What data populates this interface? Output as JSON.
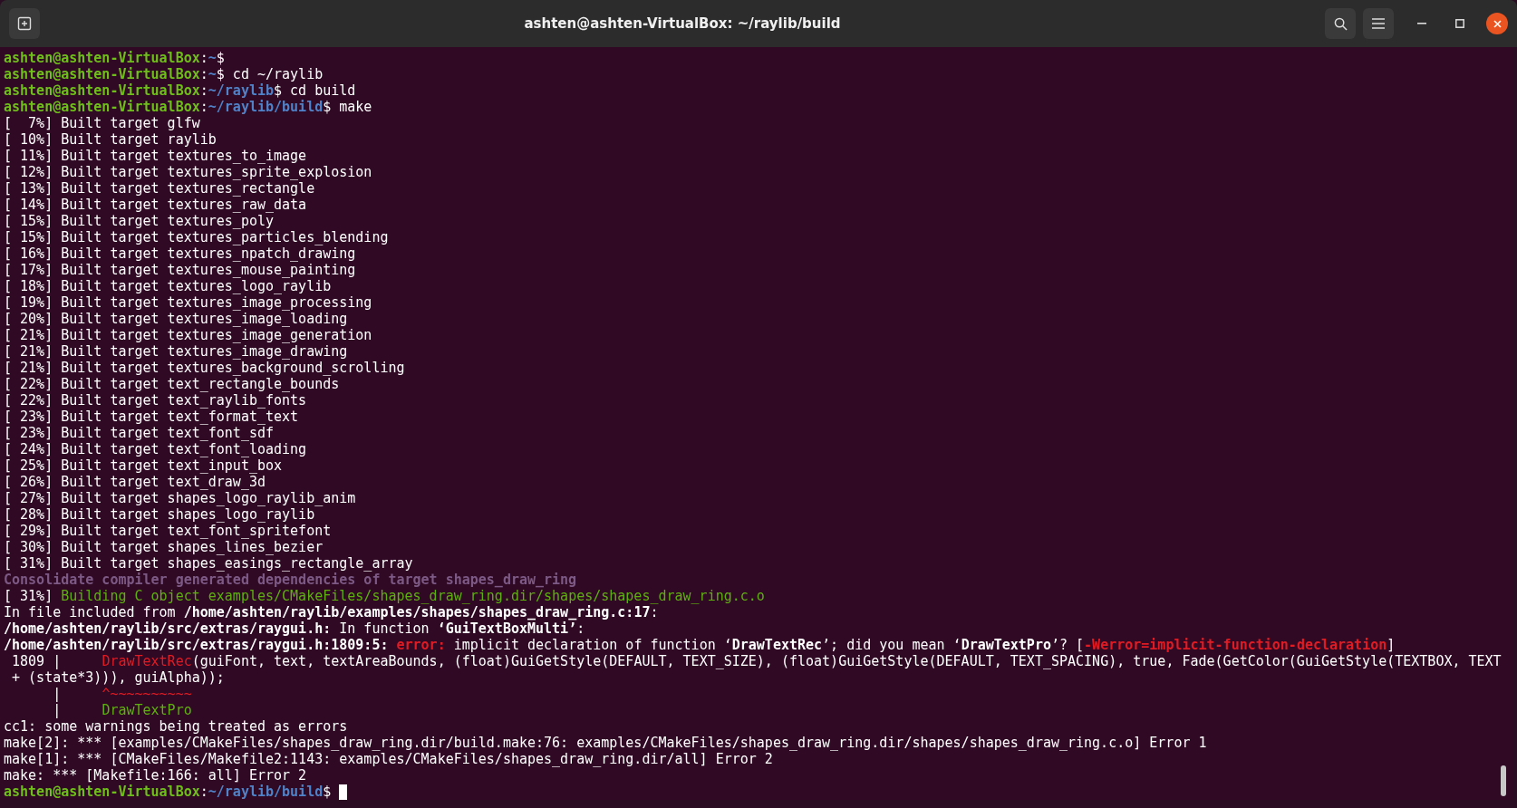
{
  "window": {
    "title": "ashten@ashten-VirtualBox: ~/raylib/build"
  },
  "terminal": {
    "cursor": true,
    "lines": [
      [
        {
          "kind": "user",
          "text": "ashten@ashten-VirtualBox"
        },
        {
          "kind": "plain",
          "text": ":"
        },
        {
          "kind": "path",
          "text": "~"
        },
        {
          "kind": "plain",
          "text": "$"
        }
      ],
      [
        {
          "kind": "user",
          "text": "ashten@ashten-VirtualBox"
        },
        {
          "kind": "plain",
          "text": ":"
        },
        {
          "kind": "path",
          "text": "~"
        },
        {
          "kind": "plain",
          "text": "$ cd ~/raylib"
        }
      ],
      [
        {
          "kind": "user",
          "text": "ashten@ashten-VirtualBox"
        },
        {
          "kind": "plain",
          "text": ":"
        },
        {
          "kind": "path",
          "text": "~/raylib"
        },
        {
          "kind": "plain",
          "text": "$ cd build"
        }
      ],
      [
        {
          "kind": "user",
          "text": "ashten@ashten-VirtualBox"
        },
        {
          "kind": "plain",
          "text": ":"
        },
        {
          "kind": "path",
          "text": "~/raylib/build"
        },
        {
          "kind": "plain",
          "text": "$ make"
        }
      ],
      [
        {
          "kind": "plain",
          "text": "[  7%] Built target glfw"
        }
      ],
      [
        {
          "kind": "plain",
          "text": "[ 10%] Built target raylib"
        }
      ],
      [
        {
          "kind": "plain",
          "text": "[ 11%] Built target textures_to_image"
        }
      ],
      [
        {
          "kind": "plain",
          "text": "[ 12%] Built target textures_sprite_explosion"
        }
      ],
      [
        {
          "kind": "plain",
          "text": "[ 13%] Built target textures_rectangle"
        }
      ],
      [
        {
          "kind": "plain",
          "text": "[ 14%] Built target textures_raw_data"
        }
      ],
      [
        {
          "kind": "plain",
          "text": "[ 15%] Built target textures_poly"
        }
      ],
      [
        {
          "kind": "plain",
          "text": "[ 15%] Built target textures_particles_blending"
        }
      ],
      [
        {
          "kind": "plain",
          "text": "[ 16%] Built target textures_npatch_drawing"
        }
      ],
      [
        {
          "kind": "plain",
          "text": "[ 17%] Built target textures_mouse_painting"
        }
      ],
      [
        {
          "kind": "plain",
          "text": "[ 18%] Built target textures_logo_raylib"
        }
      ],
      [
        {
          "kind": "plain",
          "text": "[ 19%] Built target textures_image_processing"
        }
      ],
      [
        {
          "kind": "plain",
          "text": "[ 20%] Built target textures_image_loading"
        }
      ],
      [
        {
          "kind": "plain",
          "text": "[ 21%] Built target textures_image_generation"
        }
      ],
      [
        {
          "kind": "plain",
          "text": "[ 21%] Built target textures_image_drawing"
        }
      ],
      [
        {
          "kind": "plain",
          "text": "[ 21%] Built target textures_background_scrolling"
        }
      ],
      [
        {
          "kind": "plain",
          "text": "[ 22%] Built target text_rectangle_bounds"
        }
      ],
      [
        {
          "kind": "plain",
          "text": "[ 22%] Built target text_raylib_fonts"
        }
      ],
      [
        {
          "kind": "plain",
          "text": "[ 23%] Built target text_format_text"
        }
      ],
      [
        {
          "kind": "plain",
          "text": "[ 23%] Built target text_font_sdf"
        }
      ],
      [
        {
          "kind": "plain",
          "text": "[ 24%] Built target text_font_loading"
        }
      ],
      [
        {
          "kind": "plain",
          "text": "[ 25%] Built target text_input_box"
        }
      ],
      [
        {
          "kind": "plain",
          "text": "[ 26%] Built target text_draw_3d"
        }
      ],
      [
        {
          "kind": "plain",
          "text": "[ 27%] Built target shapes_logo_raylib_anim"
        }
      ],
      [
        {
          "kind": "plain",
          "text": "[ 28%] Built target shapes_logo_raylib"
        }
      ],
      [
        {
          "kind": "plain",
          "text": "[ 29%] Built target text_font_spritefont"
        }
      ],
      [
        {
          "kind": "plain",
          "text": "[ 30%] Built target shapes_lines_bezier"
        }
      ],
      [
        {
          "kind": "plain",
          "text": "[ 31%] Built target shapes_easings_rectangle_array"
        }
      ],
      [
        {
          "kind": "magenta",
          "text": "Consolidate compiler generated dependencies of target shapes_draw_ring"
        }
      ],
      [
        {
          "kind": "plain",
          "text": "[ 31%] "
        },
        {
          "kind": "green",
          "text": "Building C object examples/CMakeFiles/shapes_draw_ring.dir/shapes/shapes_draw_ring.c.o"
        }
      ],
      [
        {
          "kind": "plain",
          "text": "In file included from "
        },
        {
          "kind": "bold",
          "text": "/home/ashten/raylib/examples/shapes/shapes_draw_ring.c:17"
        },
        {
          "kind": "plain",
          "text": ":"
        }
      ],
      [
        {
          "kind": "bold",
          "text": "/home/ashten/raylib/src/extras/raygui.h:"
        },
        {
          "kind": "plain",
          "text": " In function "
        },
        {
          "kind": "bold",
          "text": "‘GuiTextBoxMulti’"
        },
        {
          "kind": "plain",
          "text": ":"
        }
      ],
      [
        {
          "kind": "bold",
          "text": "/home/ashten/raylib/src/extras/raygui.h:1809:5:"
        },
        {
          "kind": "error",
          "text": " error:"
        },
        {
          "kind": "plain",
          "text": " implicit declaration of function ‘"
        },
        {
          "kind": "bold",
          "text": "DrawTextRec"
        },
        {
          "kind": "plain",
          "text": "’; did you mean ‘"
        },
        {
          "kind": "bold",
          "text": "DrawTextPro"
        },
        {
          "kind": "plain",
          "text": "’? ["
        },
        {
          "kind": "error",
          "text": "-Werror=implicit-function-declaration"
        },
        {
          "kind": "plain",
          "text": "]"
        }
      ],
      [
        {
          "kind": "plain",
          "text": " 1809 |     "
        },
        {
          "kind": "red",
          "text": "DrawTextRec"
        },
        {
          "kind": "plain",
          "text": "(guiFont, text, textAreaBounds, (float)GuiGetStyle(DEFAULT, TEXT_SIZE), (float)GuiGetStyle(DEFAULT, TEXT_SPACING), true, Fade(GetColor(GuiGetStyle(TEXTBOX, TEXT"
        }
      ],
      [
        {
          "kind": "plain",
          "text": " + (state*3))), guiAlpha));"
        }
      ],
      [
        {
          "kind": "plain",
          "text": "      |     "
        },
        {
          "kind": "red",
          "text": "^~~~~~~~~~~"
        }
      ],
      [
        {
          "kind": "plain",
          "text": "      |     "
        },
        {
          "kind": "green",
          "text": "DrawTextPro"
        }
      ],
      [
        {
          "kind": "plain",
          "text": "cc1: some warnings being treated as errors"
        }
      ],
      [
        {
          "kind": "plain",
          "text": "make[2]: *** [examples/CMakeFiles/shapes_draw_ring.dir/build.make:76: examples/CMakeFiles/shapes_draw_ring.dir/shapes/shapes_draw_ring.c.o] Error 1"
        }
      ],
      [
        {
          "kind": "plain",
          "text": "make[1]: *** [CMakeFiles/Makefile2:1143: examples/CMakeFiles/shapes_draw_ring.dir/all] Error 2"
        }
      ],
      [
        {
          "kind": "plain",
          "text": "make: *** [Makefile:166: all] Error 2"
        }
      ],
      [
        {
          "kind": "user",
          "text": "ashten@ashten-VirtualBox"
        },
        {
          "kind": "plain",
          "text": ":"
        },
        {
          "kind": "path",
          "text": "~/raylib/build"
        },
        {
          "kind": "plain",
          "text": "$"
        }
      ]
    ]
  }
}
